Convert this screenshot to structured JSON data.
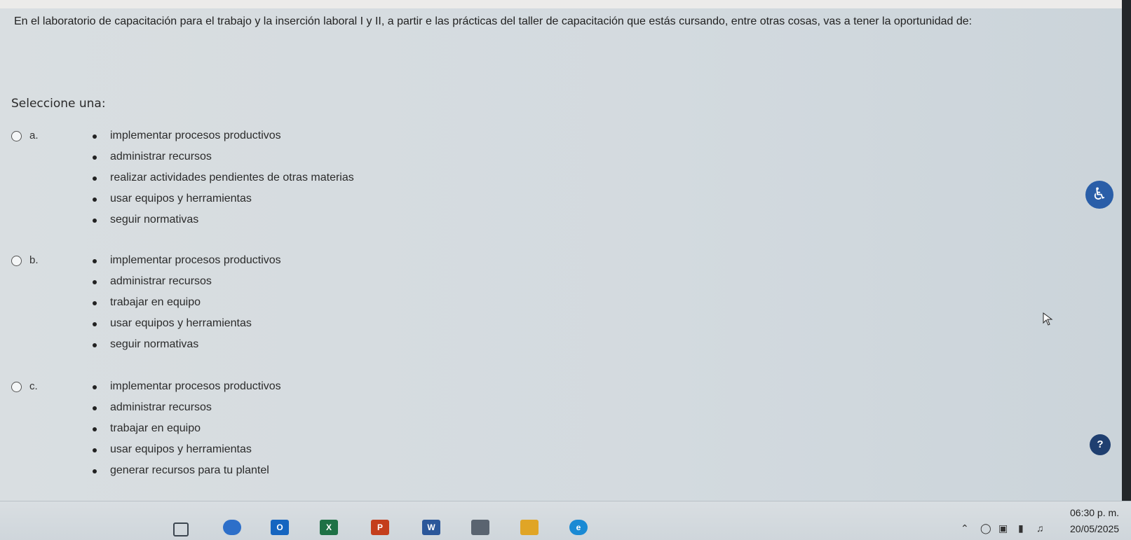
{
  "question": {
    "text": "En el laboratorio de capacitación para el trabajo y la inserción laboral I y II, a partir e las prácticas del taller de capacitación que estás cursando, entre otras cosas, vas a tener la oportunidad de:"
  },
  "select_label": "Seleccione una:",
  "options": [
    {
      "letter": "a.",
      "items": [
        "implementar procesos productivos",
        "administrar recursos",
        "realizar actividades pendientes de otras materias",
        "usar equipos y herramientas",
        "seguir normativas"
      ]
    },
    {
      "letter": "b.",
      "items": [
        "implementar procesos productivos",
        "administrar recursos",
        "trabajar en equipo",
        "usar equipos y herramientas",
        "seguir normativas"
      ]
    },
    {
      "letter": "c.",
      "items": [
        "implementar procesos productivos",
        "administrar recursos",
        "trabajar en equipo",
        "usar equipos y herramientas",
        "generar recursos para tu plantel"
      ]
    }
  ],
  "accessibility_button": {
    "icon": "accessibility-icon"
  },
  "help_button": {
    "label": "?"
  },
  "taskbar": {
    "apps": [
      {
        "name": "task-view-icon",
        "glyph": "",
        "color": "#3c4650"
      },
      {
        "name": "onedrive-icon",
        "glyph": "",
        "color": "#2d6fc9"
      },
      {
        "name": "outlook-icon",
        "glyph": "O",
        "color": "#1565c0"
      },
      {
        "name": "excel-icon",
        "glyph": "X",
        "color": "#1e7145"
      },
      {
        "name": "powerpoint-icon",
        "glyph": "P",
        "color": "#c43e1c"
      },
      {
        "name": "word-icon",
        "glyph": "W",
        "color": "#2b579a"
      },
      {
        "name": "printer-icon",
        "glyph": "",
        "color": "#5a6470"
      },
      {
        "name": "file-explorer-icon",
        "glyph": "",
        "color": "#e0a526"
      },
      {
        "name": "edge-icon",
        "glyph": "e",
        "color": "#1a8ad4"
      }
    ],
    "time": "06:30 p. m.",
    "date": "20/05/2025"
  }
}
